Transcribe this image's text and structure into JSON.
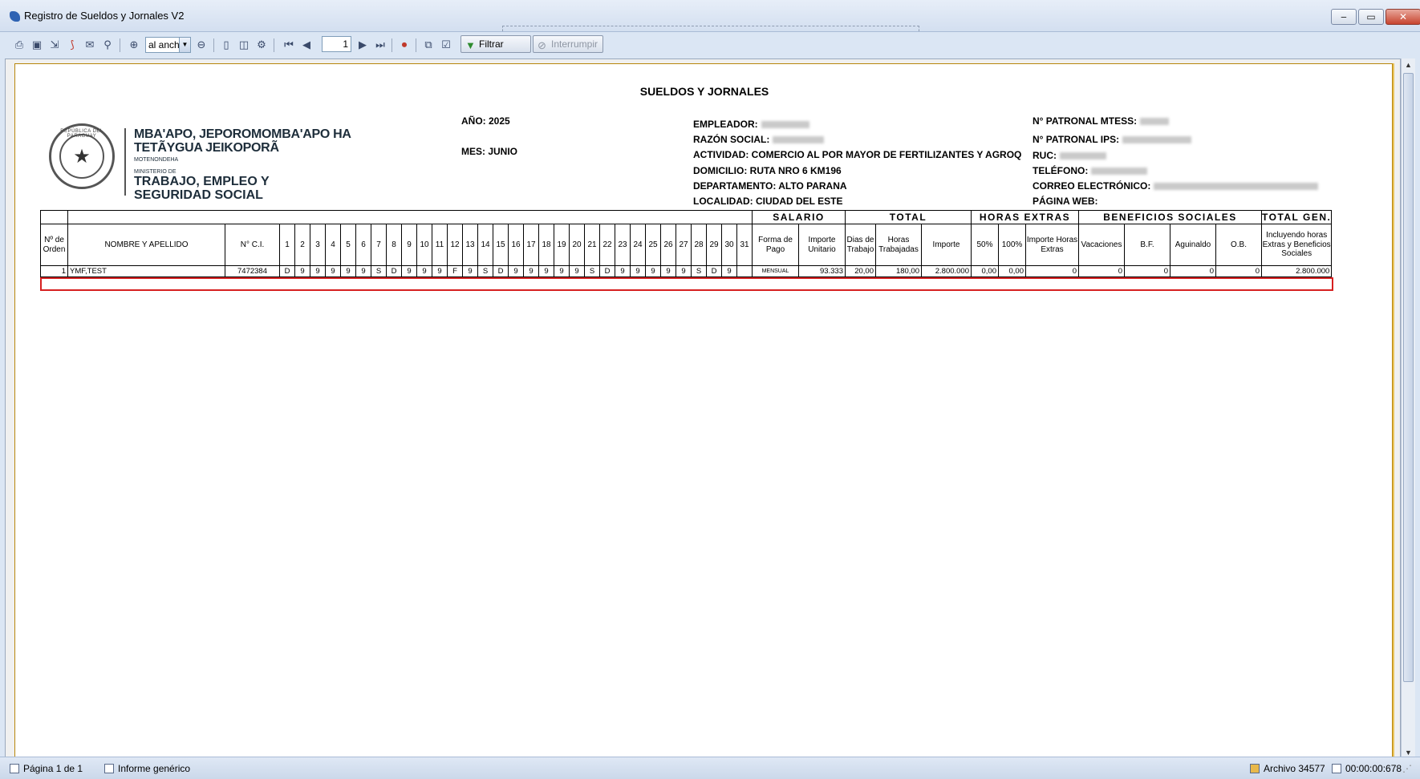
{
  "window": {
    "title": "Registro de Sueldos y Jornales V2",
    "minimize": "‒",
    "maximize": "▭",
    "close": "✕"
  },
  "toolbar": {
    "icons": [
      "print-icon",
      "save-icon",
      "export-icon",
      "pdf-icon",
      "email-icon",
      "find-icon",
      "zoom-in-icon",
      "zoom-out-icon",
      "single-page-icon",
      "two-pages-icon",
      "page-setup-icon",
      "first-page-icon",
      "prev-page-icon",
      "next-page-icon",
      "last-page-icon",
      "stop-icon",
      "copy-icon",
      "settings-icon"
    ],
    "zoom_value": "al ancho",
    "page_number": "1",
    "filter_label": "Filtrar",
    "interrupt_label": "Interrumpir"
  },
  "report": {
    "title": "SUELDOS Y JORNALES",
    "logo": {
      "line1": "MBA'APO, JEPOROMOMBA'APO HA",
      "line2": "TETÃYGUA JEIKOPORÃ",
      "line3": "MOTENONDEHA",
      "line4": "MINISTERIO DE",
      "line5": "TRABAJO, EMPLEO Y",
      "line6": "SEGURIDAD SOCIAL",
      "seal_text": "REPÚBLICA DEL PARAGUAY"
    },
    "anio": "AÑO: 2025",
    "mes": "MES: JUNIO",
    "empleador": "EMPLEADOR:",
    "razon_social": "RAZÓN SOCIAL:",
    "actividad": "ACTIVIDAD: COMERCIO AL POR MAYOR DE FERTILIZANTES Y AGROQUI",
    "domicilio": "DOMICILIO: RUTA NRO 6 KM196",
    "departamento": "DEPARTAMENTO: ALTO PARANA",
    "localidad": "LOCALIDAD: CIUDAD DEL ESTE",
    "patronal_mtess": "N° PATRONAL MTESS:",
    "patronal_ips": "N° PATRONAL IPS:",
    "ruc": "RUC:",
    "telefono": "TELÉFONO:",
    "correo": "CORREO ELECTRÓNICO:",
    "pagina_web": "PÁGINA WEB:"
  },
  "table": {
    "groups": {
      "salario": "SALARIO",
      "total": "TOTAL",
      "horas_extras": "HORAS  EXTRAS",
      "beneficios": "BENEFICIOS SOCIALES",
      "total_gen": "TOTAL GEN."
    },
    "headers": {
      "orden": "Nº de Orden",
      "nombre": "NOMBRE Y APELLIDO",
      "ci": "N° C.I.",
      "days": [
        "1",
        "2",
        "3",
        "4",
        "5",
        "6",
        "7",
        "8",
        "9",
        "10",
        "11",
        "12",
        "13",
        "14",
        "15",
        "16",
        "17",
        "18",
        "19",
        "20",
        "21",
        "22",
        "23",
        "24",
        "25",
        "26",
        "27",
        "28",
        "29",
        "30",
        "31"
      ],
      "forma_pago": "Forma de Pago",
      "importe_unitario": "Importe Unitario",
      "dias_trabajo": "Dias de Trabajo",
      "horas_trabajadas": "Horas Trabajadas",
      "importe": "Importe",
      "p50": "50%",
      "p100": "100%",
      "importe_he": "Importe Horas Extras",
      "vacaciones": "Vacaciones",
      "bf": "B.F.",
      "aguinaldo": "Aguinaldo",
      "ob": "O.B.",
      "incluyendo": "Incluyendo horas Extras y Beneficios Sociales"
    },
    "rows": [
      {
        "orden": "1",
        "nombre": "YMF,TEST",
        "ci": "7472384",
        "days": [
          "D",
          "9",
          "9",
          "9",
          "9",
          "9",
          "S",
          "D",
          "9",
          "9",
          "9",
          "F",
          "9",
          "S",
          "D",
          "9",
          "9",
          "9",
          "9",
          "9",
          "S",
          "D",
          "9",
          "9",
          "9",
          "9",
          "9",
          "S",
          "D",
          "9",
          ""
        ],
        "forma_pago": "MENSUAL",
        "importe_unitario": "93.333",
        "dias_trabajo": "20,00",
        "horas_trabajadas": "180,00",
        "importe": "2.800.000",
        "p50": "0,00",
        "p100": "0,00",
        "importe_he": "0",
        "vacaciones": "0",
        "bf": "0",
        "aguinaldo": "0",
        "ob": "0",
        "total_gen": "2.800.000"
      }
    ]
  },
  "status": {
    "page": "Página 1 de 1",
    "report_type": "Informe genérico",
    "archivo": "Archivo 34577",
    "timer": "00:00:00:678"
  }
}
